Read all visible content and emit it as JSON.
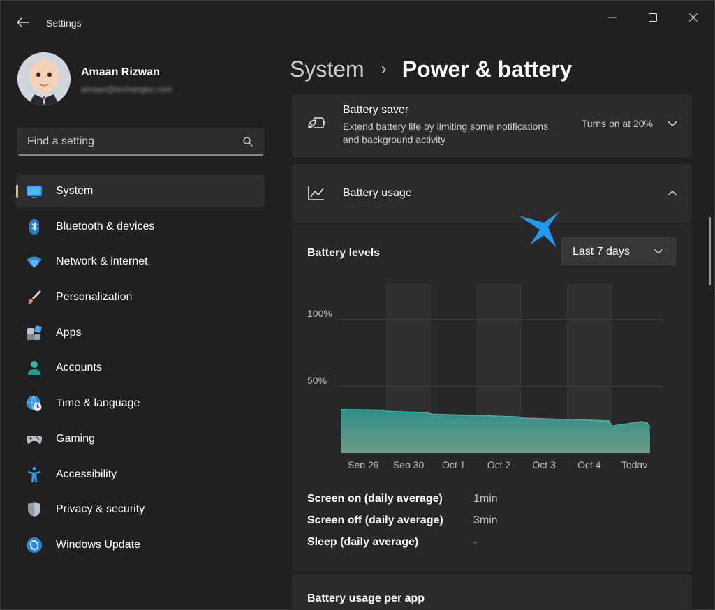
{
  "window": {
    "title": "Settings",
    "controls": [
      "minimize",
      "maximize",
      "close"
    ]
  },
  "profile": {
    "name": "Amaan Rizwan",
    "email": "amaan@techangler.com"
  },
  "search": {
    "placeholder": "Find a setting"
  },
  "sidebar": {
    "items": [
      {
        "label": "System",
        "icon": "monitor-icon",
        "active": true
      },
      {
        "label": "Bluetooth & devices",
        "icon": "bluetooth-icon"
      },
      {
        "label": "Network & internet",
        "icon": "wifi-icon"
      },
      {
        "label": "Personalization",
        "icon": "paintbrush-icon"
      },
      {
        "label": "Apps",
        "icon": "apps-icon"
      },
      {
        "label": "Accounts",
        "icon": "person-icon"
      },
      {
        "label": "Time & language",
        "icon": "globe-clock-icon"
      },
      {
        "label": "Gaming",
        "icon": "gamepad-icon"
      },
      {
        "label": "Accessibility",
        "icon": "accessibility-icon"
      },
      {
        "label": "Privacy & security",
        "icon": "shield-icon"
      },
      {
        "label": "Windows Update",
        "icon": "update-icon"
      }
    ]
  },
  "breadcrumb": {
    "parent": "System",
    "separator": "›",
    "current": "Power & battery"
  },
  "battery_saver": {
    "title": "Battery saver",
    "description": "Extend battery life by limiting some notifications and background activity",
    "status": "Turns on at 20%"
  },
  "battery_usage": {
    "title": "Battery usage",
    "levels_label": "Battery levels",
    "range": "Last 7 days"
  },
  "stats": [
    {
      "label": "Screen on (daily average)",
      "value": "1min"
    },
    {
      "label": "Screen off (daily average)",
      "value": "3min"
    },
    {
      "label": "Sleep (daily average)",
      "value": "-"
    }
  ],
  "per_app": {
    "title": "Battery usage per app"
  },
  "colors": {
    "accent": "#e9b88c",
    "chart_fill_top": "#2e8f8a",
    "chart_fill_bottom": "#6f9a86",
    "annotation_arrow": "#1e9bf0"
  },
  "chart_data": {
    "type": "area",
    "categories": [
      "Sep 29",
      "Sep 30",
      "Oct 1",
      "Oct 2",
      "Oct 3",
      "Oct 4",
      "Today"
    ],
    "values": [
      33,
      31,
      29,
      28,
      26,
      25,
      20
    ],
    "y_ticks": [
      "100%",
      "50%"
    ],
    "ylim": [
      0,
      100
    ],
    "shaded_days": [
      "Sep 30",
      "Oct 2",
      "Oct 4"
    ],
    "grid": true
  }
}
